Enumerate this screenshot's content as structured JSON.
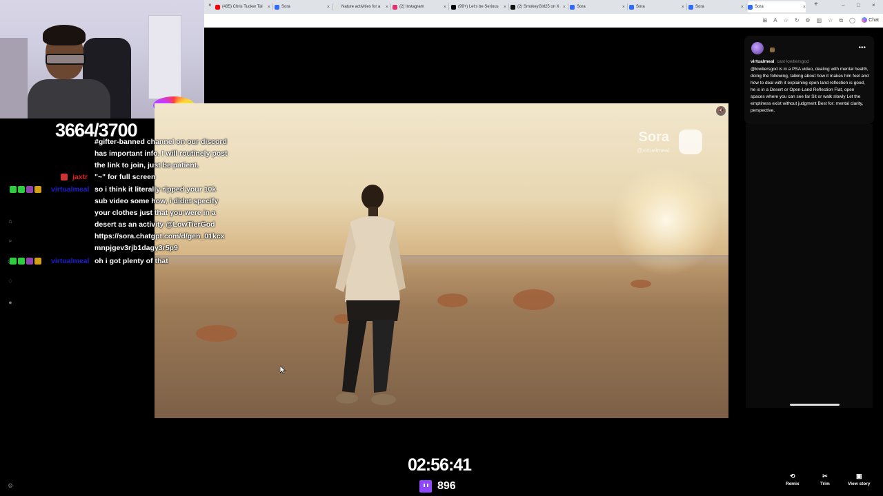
{
  "browser": {
    "tabs": [
      {
        "label": "(435) Chris Tucker Tal",
        "fav_color": "#ff0000"
      },
      {
        "label": "Sora",
        "fav_color": "#2f6bff"
      },
      {
        "label": "Nature activities for a",
        "fav_color": "#e0e0e0"
      },
      {
        "label": "(2) Instagram",
        "fav_color": "#e1306c"
      },
      {
        "label": "(99+) Let's be Serious",
        "fav_color": "#000000"
      },
      {
        "label": "(2) SmokeyGirl25 on X",
        "fav_color": "#111111"
      },
      {
        "label": "Sora",
        "fav_color": "#2f6bff"
      },
      {
        "label": "Sora",
        "fav_color": "#2f6bff"
      },
      {
        "label": "Sora",
        "fav_color": "#2f6bff"
      },
      {
        "label": "Sora",
        "fav_color": "#2f6bff"
      }
    ],
    "new_tab": "+",
    "chat_label": "Chat"
  },
  "stream": {
    "goal_counter": "3664/3700",
    "timer": "02:56:41",
    "viewer_count": "896"
  },
  "chat_messages": [
    {
      "user": "",
      "user_color": "#ffffff",
      "lines": [
        "#gifter-banned channel on our discord",
        "has important info. I will routinely post",
        "the link to join, just be patient."
      ]
    },
    {
      "user": "jaxtr",
      "user_color": "#e02020",
      "lines": [
        "\"~\" for full screen"
      ]
    },
    {
      "user": "virtualmeal",
      "user_color": "#1e1ecc",
      "lines": [
        "so i think it literally ripped your 10k",
        "sub video some how, i didnt specify",
        "your clothes just that you were in a",
        "desert as an activity @LowTierGod",
        "https://sora.chatgpt.com/d/gen_01kcx",
        "mnpjgev3rjb1dagy3r5p9"
      ]
    },
    {
      "user": "virtualmeal",
      "user_color": "#1e1ecc",
      "lines": [
        "oh i got plenty of that"
      ]
    }
  ],
  "video": {
    "watermark_brand": "Sora",
    "watermark_user": "@virtualmeal"
  },
  "post": {
    "username": "virtualmeal",
    "cast_text": "cast lowtiersgod",
    "description": "@lowtiersgod is in a PSA video, dealing with mental health, doing the following, talking about how it makes him feel and how to deal with it explaining open land reflection is good, he is in a Desert or Open-Land Reflection Flat, open spaces where you can see far Sit or walk slowly Let the emptiness exist without judgment Best for: mental clarity, perspective,",
    "actions": [
      {
        "label": "Remix",
        "icon": "remix-icon"
      },
      {
        "label": "Trim",
        "icon": "scissors-icon"
      },
      {
        "label": "View story",
        "icon": "story-icon"
      }
    ]
  },
  "colors": {
    "twitch": "#9146ff",
    "desert_sky": "#f2e7cc",
    "desert_ground": "#9c7a57"
  }
}
